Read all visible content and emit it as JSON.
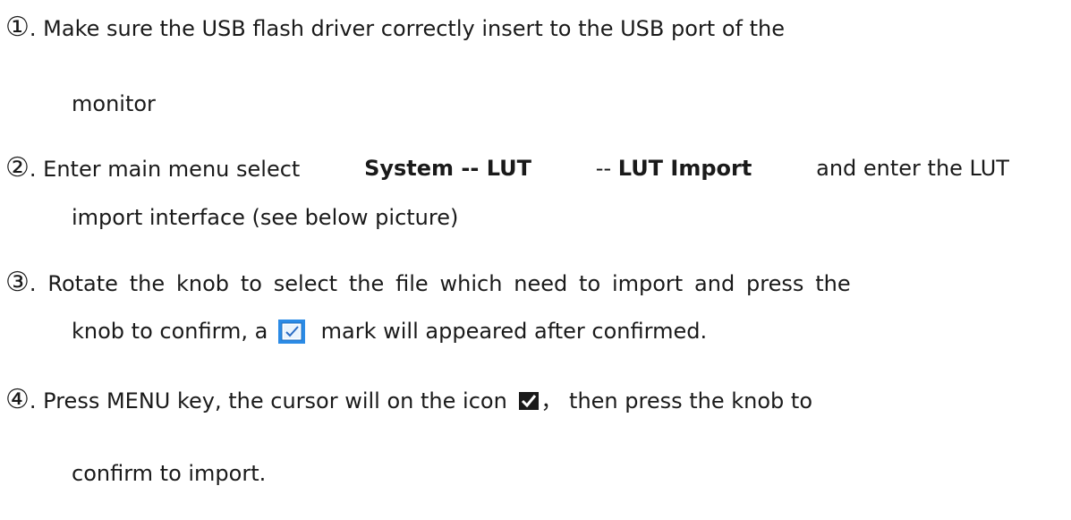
{
  "step1": {
    "marker": "①",
    "line1": ". Make sure the USB flash driver correctly insert to the USB port of the",
    "line2": "monitor"
  },
  "step2": {
    "marker": "②",
    "l1_prefix": ". Enter main menu select",
    "l1_bold1": "System -- LUT",
    "l1_sep": "--",
    "l1_bold2": "LUT Import",
    "l1_suffix": "and enter the LUT",
    "line2": "import interface (see below picture)"
  },
  "step3": {
    "marker": "③",
    "line1": ". Rotate the knob to select the file which need to import and press the",
    "l2_prefix": "knob to confirm, a",
    "l2_suffix": "mark will appeared after confirmed."
  },
  "step4": {
    "marker": "④",
    "l1_prefix": ". Press MENU key, the cursor will on the icon",
    "l1_suffix": "， then press the knob to",
    "line2": "confirm to import."
  },
  "icons": {
    "blue_check_color": "#2b8be6",
    "black_check_color": "#1a1a1a"
  }
}
